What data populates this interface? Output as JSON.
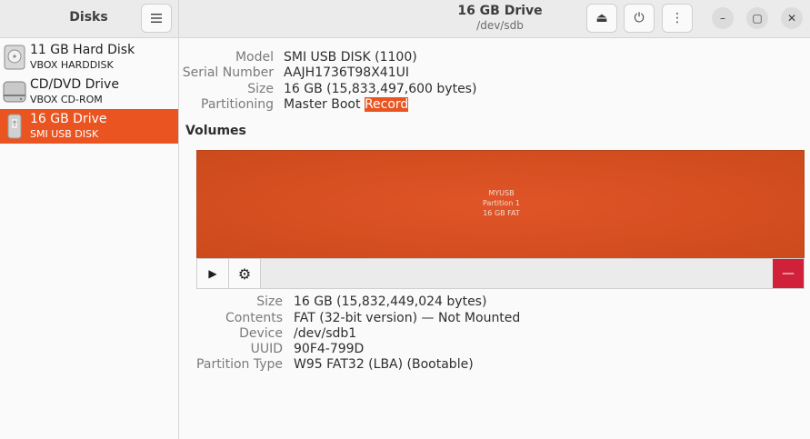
{
  "sidebar": {
    "title": "Disks",
    "menu_icon": "hamburger-menu-icon",
    "drives": [
      {
        "name": "11 GB Hard Disk",
        "sub": "VBOX HARDDISK",
        "icon": "hard-disk-icon"
      },
      {
        "name": "CD/DVD Drive",
        "sub": "VBOX CD-ROM",
        "icon": "optical-drive-icon"
      },
      {
        "name": "16 GB Drive",
        "sub": "SMI USB DISK",
        "icon": "usb-drive-icon",
        "selected": true
      }
    ]
  },
  "header": {
    "title": "16 GB Drive",
    "subtitle": "/dev/sdb",
    "eject_glyph": "⏏",
    "power_glyph": "⏻",
    "more_glyph": "⋮",
    "min_glyph": "–",
    "max_glyph": "▢",
    "close_glyph": "✕"
  },
  "drive_info": {
    "model_key": "Model",
    "model_val": "SMI USB DISK (1100)",
    "serial_key": "Serial Number",
    "serial_val": "AAJH1736T98X41UI",
    "size_key": "Size",
    "size_val": "16 GB (15,833,497,600 bytes)",
    "partitioning_key": "Partitioning",
    "partitioning_val_1": "Master Boot ",
    "partitioning_val_2": "Record"
  },
  "volumes": {
    "title": "Volumes",
    "partition": {
      "label": "MYUSB",
      "name": "Partition 1",
      "size": "16 GB FAT"
    },
    "toolbar": {
      "play_glyph": "▶",
      "gear_glyph": "⚙",
      "delete_glyph": "—"
    }
  },
  "partition_info": {
    "size_key": "Size",
    "size_val": "16 GB (15,832,449,024 bytes)",
    "contents_key": "Contents",
    "contents_val": "FAT (32-bit version) — Not Mounted",
    "device_key": "Device",
    "device_val": "/dev/sdb1",
    "uuid_key": "UUID",
    "uuid_val": "90F4-799D",
    "type_key": "Partition Type",
    "type_val": "W95 FAT32 (LBA) (Bootable)"
  },
  "colors": {
    "accent": "#e95420",
    "danger": "#d0203a"
  }
}
